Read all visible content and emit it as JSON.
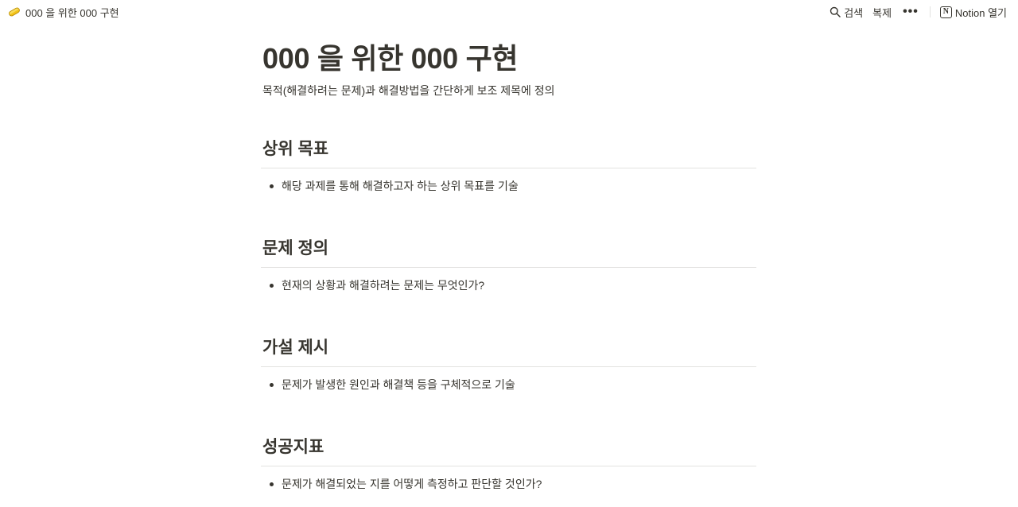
{
  "topbar": {
    "page_title": "000 을 위한 000 구현",
    "search_label": "검색",
    "duplicate_label": "복제",
    "more_label": "•••",
    "open_notion_label": "Notion 열기"
  },
  "page": {
    "title": "000 을 위한 000 구현",
    "subtitle": "목적(해결하려는 문제)과 해결방법을 간단하게 보조 제목에 정의",
    "sections": [
      {
        "heading": "상위 목표",
        "bullet": "해당 과제를 통해 해결하고자 하는 상위 목표를 기술"
      },
      {
        "heading": "문제 정의",
        "bullet": "현재의 상황과 해결하려는 문제는 무엇인가?"
      },
      {
        "heading": "가설 제시",
        "bullet": "문제가 발생한 원인과 해결책 등을 구체적으로 기술"
      },
      {
        "heading": "성공지표",
        "bullet": "문제가 해결되었는 지를 어떻게 측정하고 판단할 것인가?"
      }
    ]
  }
}
